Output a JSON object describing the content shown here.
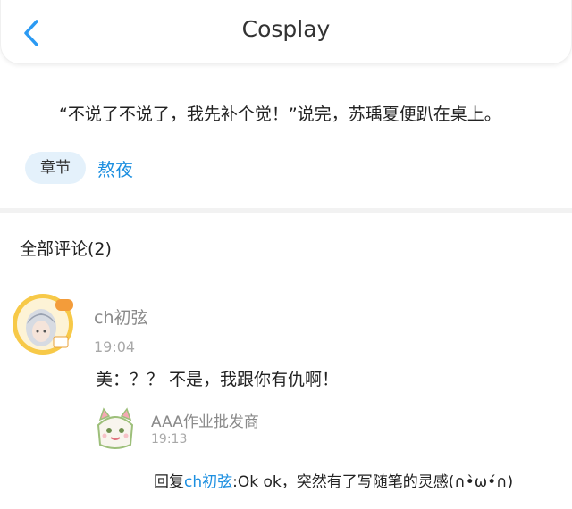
{
  "header": {
    "title": "Cosplay",
    "back_icon": "chevron-left-icon",
    "accent": "#2b9af3"
  },
  "post": {
    "quote": "“不说了不说了，我先补个觉！”说完，苏瑀夏便趴在桌上。",
    "tag_label": "章节",
    "chapter_title": "熬夜"
  },
  "comments": {
    "heading": "全部评论(2)",
    "items": [
      {
        "username": "ch初弦",
        "time": "19:04",
        "text": "美：？？ 不是，我跟你有仇啊！",
        "replies": [
          {
            "username": "AAA作业批发商",
            "time": "19:13",
            "prefix": "回复",
            "mention": "ch初弦",
            "text": ":Ok ok，突然有了写随笔的灵感(∩•̀ω•́∩)"
          }
        ]
      }
    ]
  },
  "colors": {
    "link": "#1d8fe0",
    "tag_bg": "#e4f1fb",
    "divider": "#f2f2f2"
  }
}
